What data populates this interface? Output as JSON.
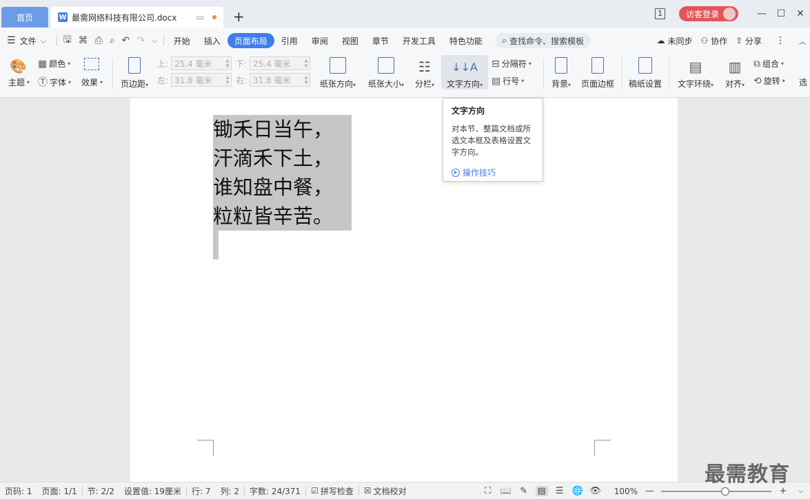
{
  "titlebar": {
    "home_tab": "首页",
    "doc_tab": "最需网络科技有限公司.docx",
    "new_tab_symbol": "+",
    "login_label": "访客登录",
    "page_icon_label": "1"
  },
  "menubar": {
    "file_label": "文件",
    "tabs": [
      "开始",
      "插入",
      "页面布局",
      "引用",
      "审阅",
      "视图",
      "章节",
      "开发工具",
      "特色功能"
    ],
    "active_tab": "页面布局",
    "search_placeholder": "查找命令、搜索模板",
    "right_items": [
      "未同步",
      "协作",
      "分享"
    ]
  },
  "ribbon": {
    "theme": "主题",
    "color": "颜色",
    "font": "字体",
    "effect": "效果",
    "margins": "页边距",
    "top_label": "上:",
    "top_value": "25.4 毫米",
    "bottom_label": "下:",
    "bottom_value": "25.4 毫米",
    "left_label": "左:",
    "left_value": "31.8 毫米",
    "right_label": "右:",
    "right_value": "31.8 毫米",
    "orientation": "纸张方向",
    "size": "纸张大小",
    "columns": "分栏",
    "text_direction": "文字方向",
    "breaks": "分隔符",
    "line_numbers": "行号",
    "background": "背景",
    "page_border": "页面边框",
    "manuscript": "稿纸设置",
    "text_wrap": "文字环绕",
    "align": "对齐",
    "group": "组合",
    "rotate": "旋转",
    "select": "选"
  },
  "tooltip": {
    "title": "文字方向",
    "body": "对本节、整篇文档或所选文本框及表格设置文字方向。",
    "link": "操作技巧"
  },
  "document": {
    "lines": [
      "锄禾日当午，",
      "汗滴禾下土，",
      "谁知盘中餐，",
      "粒粒皆辛苦。"
    ]
  },
  "statusbar": {
    "page_no": "页码: 1",
    "pages": "页面: 1/1",
    "section": "节: 2/2",
    "setting": "设置值: 19厘米",
    "row": "行: 7",
    "col": "列: 2",
    "word_count": "字数: 24/371",
    "spell_check": "拼写检查",
    "doc_proof": "文档校对",
    "zoom": "100%",
    "zoom_fraction": 0.58
  },
  "watermark": "最需教育",
  "colors": {
    "accent": "#3f7ee8",
    "home_tab": "#6c9ce6",
    "login": "#e2565a",
    "selection": "#c6c6c6"
  }
}
